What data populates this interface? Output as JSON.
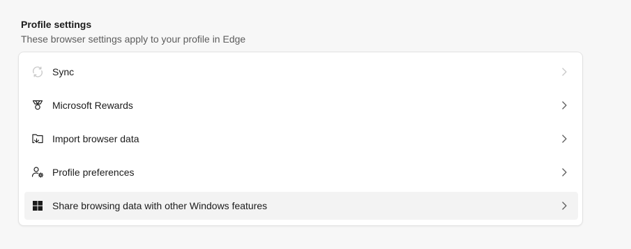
{
  "section": {
    "title": "Profile settings",
    "subtitle": "These browser settings apply to your profile in Edge"
  },
  "items": [
    {
      "label": "Sync",
      "icon": "sync-icon",
      "disabled": true
    },
    {
      "label": "Microsoft Rewards",
      "icon": "rewards-trophy-icon",
      "disabled": false
    },
    {
      "label": "Import browser data",
      "icon": "import-data-icon",
      "disabled": false
    },
    {
      "label": "Profile preferences",
      "icon": "profile-preferences-icon",
      "disabled": false
    },
    {
      "label": "Share browsing data with other Windows features",
      "icon": "windows-logo-icon",
      "disabled": false,
      "hovered": true
    }
  ],
  "colors": {
    "page_background": "#f7f7f7",
    "card_background": "#ffffff",
    "hover_background": "#f3f3f3",
    "text_primary": "#1b1b1b",
    "text_secondary": "#5c5c5c",
    "icon_disabled": "#c8c8c8",
    "chevron": "#5c5c5c",
    "chevron_disabled": "#c8c8c8"
  }
}
